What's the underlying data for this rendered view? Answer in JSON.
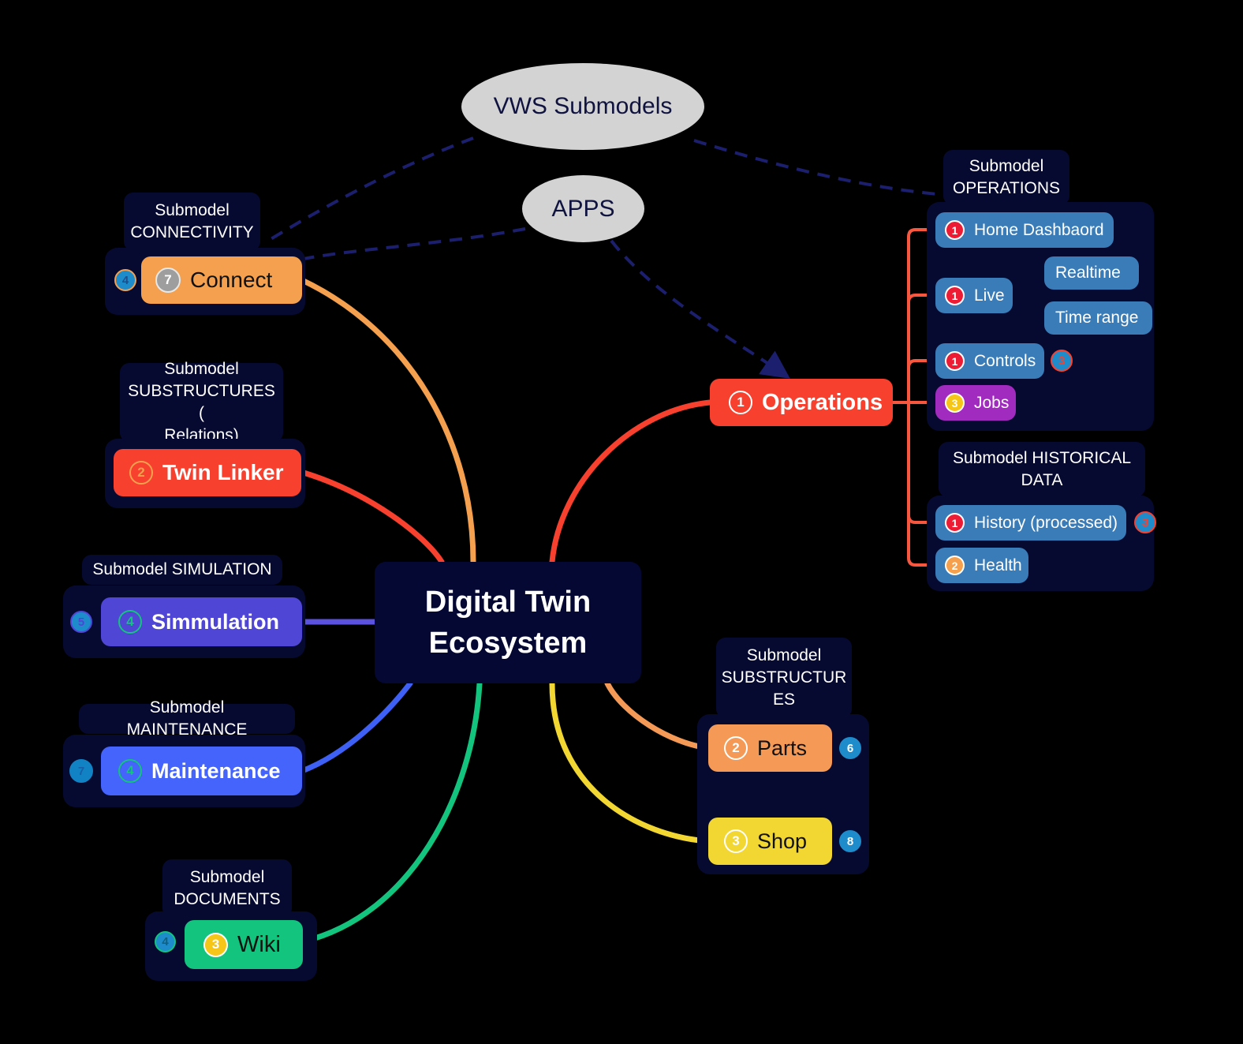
{
  "diagram": {
    "title": "Digital Twin Ecosystem",
    "center": {
      "label": "Digital Twin Ecosystem"
    },
    "ellipses": [
      {
        "name": "vws-submodels",
        "label": "VWS Submodels"
      },
      {
        "name": "apps",
        "label": "APPS"
      }
    ],
    "groups": [
      {
        "name": "connectivity",
        "label": "Submodel\nCONNECTIVITY",
        "label_line1": "Submodel",
        "label_line2": "CONNECTIVITY"
      },
      {
        "name": "substructures-relations",
        "label_line1": "Submodel",
        "label_line2": "SUBSTRUCTURES (",
        "label_line3": "Relations)"
      },
      {
        "name": "simulation",
        "label_line1": "Submodel  SIMULATION"
      },
      {
        "name": "maintenance",
        "label_line1": "Submodel MAINTENANCE"
      },
      {
        "name": "documents",
        "label_line1": "Submodel",
        "label_line2": "DOCUMENTS"
      },
      {
        "name": "operations",
        "label_line1": "Submodel",
        "label_line2": "OPERATIONS"
      },
      {
        "name": "historical-data",
        "label_line1": "Submodel HISTORICAL",
        "label_line2": "DATA"
      },
      {
        "name": "substructures",
        "label_line1": "Submodel",
        "label_line2": "SUBSTRUCTUR",
        "label_line3": "ES"
      }
    ],
    "nodes": [
      {
        "name": "connect",
        "label": "Connect",
        "badge": "7",
        "badge_style": "gray-ring",
        "text_color": "#111111",
        "fill": "#f4a04e",
        "side_badge": "4",
        "side_badge_position": "left",
        "side_badge_fill": "#1e8ccb",
        "side_badge_border": "#f4a04e",
        "side_badge_text": "#1e4f8c"
      },
      {
        "name": "twin-linker",
        "label": "Twin Linker",
        "badge": "2",
        "badge_style": "orange-ring",
        "text_color": "#ffffff",
        "fill": "#f8402f"
      },
      {
        "name": "simmulation",
        "label": "Simmulation",
        "badge": "4",
        "badge_style": "green-ring",
        "text_color": "#ffffff",
        "fill": "#4f46d6",
        "side_badge": "5",
        "side_badge_position": "left",
        "side_badge_fill": "#1e8ccb",
        "side_badge_border": "#4f46d6",
        "side_badge_text": "#4f46d6"
      },
      {
        "name": "maintenance",
        "label": "Maintenance",
        "badge": "4",
        "badge_style": "green-ring",
        "text_color": "#ffffff",
        "fill": "#4464fb",
        "side_badge": "7",
        "side_badge_position": "left",
        "side_badge_fill": "#1182c4",
        "side_badge_border": "#1182c4",
        "side_badge_text": "#1560a8"
      },
      {
        "name": "wiki",
        "label": "Wiki",
        "badge": "3",
        "badge_style": "yellow-ring",
        "text_color": "#111111",
        "fill": "#13c47e",
        "side_badge": "4",
        "side_badge_position": "left",
        "side_badge_fill": "#1e8ccb",
        "side_badge_border": "#13c47e",
        "side_badge_text": "#11607e"
      },
      {
        "name": "parts",
        "label": "Parts",
        "badge": "2",
        "badge_style": "white-ring",
        "text_color": "#111111",
        "fill": "#f49a56",
        "side_badge": "6",
        "side_badge_position": "right",
        "side_badge_fill": "#1e8ccb",
        "side_badge_border": "#1e8ccb",
        "side_badge_text": "#ffffff"
      },
      {
        "name": "shop",
        "label": "Shop",
        "badge": "3",
        "badge_style": "white-ring",
        "text_color": "#111111",
        "fill": "#f2d733",
        "side_badge": "8",
        "side_badge_position": "right",
        "side_badge_fill": "#1e8ccb",
        "side_badge_border": "#1e8ccb",
        "side_badge_text": "#ffffff"
      },
      {
        "name": "operations",
        "label": "Operations",
        "badge": "1",
        "badge_style": "white-ring",
        "text_color": "#ffffff",
        "fill": "#f8402f"
      },
      {
        "name": "home-dashbaord",
        "label": "Home Dashbaord",
        "badge": "1",
        "badge_style": "red-solid",
        "text_color": "#ffffff",
        "fill": "#3a7cb8"
      },
      {
        "name": "live",
        "label": "Live",
        "badge": "1",
        "badge_style": "red-solid",
        "text_color": "#ffffff",
        "fill": "#3a7cb8"
      },
      {
        "name": "realtime",
        "label": "Realtime",
        "badge": "",
        "badge_style": "none",
        "text_color": "#ffffff",
        "fill": "#3a7cb8"
      },
      {
        "name": "time-range",
        "label": "Time range",
        "badge": "",
        "badge_style": "none",
        "text_color": "#ffffff",
        "fill": "#3a7cb8"
      },
      {
        "name": "controls",
        "label": "Controls",
        "badge": "1",
        "badge_style": "red-solid",
        "text_color": "#ffffff",
        "fill": "#3a7cb8",
        "side_badge": "3",
        "side_badge_position": "right",
        "side_badge_fill": "#1e8ccb",
        "side_badge_border": "#f8402f",
        "side_badge_text": "#f8402f"
      },
      {
        "name": "jobs",
        "label": "Jobs",
        "badge": "3",
        "badge_style": "yellow-solid",
        "text_color": "#ffffff",
        "fill": "#a22bbf"
      },
      {
        "name": "history-processed",
        "label": "History (processed)",
        "badge": "1",
        "badge_style": "red-solid",
        "text_color": "#ffffff",
        "fill": "#3a7cb8",
        "side_badge": "3",
        "side_badge_position": "right",
        "side_badge_fill": "#1e8ccb",
        "side_badge_border": "#f8402f",
        "side_badge_text": "#f8402f"
      },
      {
        "name": "health",
        "label": "Health",
        "badge": "2",
        "badge_style": "orange-solid",
        "text_color": "#ffffff",
        "fill": "#3a7cb8"
      }
    ],
    "colors": {
      "background": "#000000",
      "group_fill": "#070a30",
      "center_fill": "#050833",
      "ellipse_fill": "#d3d3d3",
      "edge_connect": "#f4a04e",
      "edge_twin_linker": "#f8402f",
      "edge_simmulation": "#5b52e0",
      "edge_maintenance": "#3f60f5",
      "edge_wiki": "#13c47e",
      "edge_parts": "#f49a56",
      "edge_shop": "#f2d733",
      "edge_operations": "#f8402f",
      "edge_dashed": "#1b1f6e",
      "tree_connector": "#f8573f"
    }
  }
}
